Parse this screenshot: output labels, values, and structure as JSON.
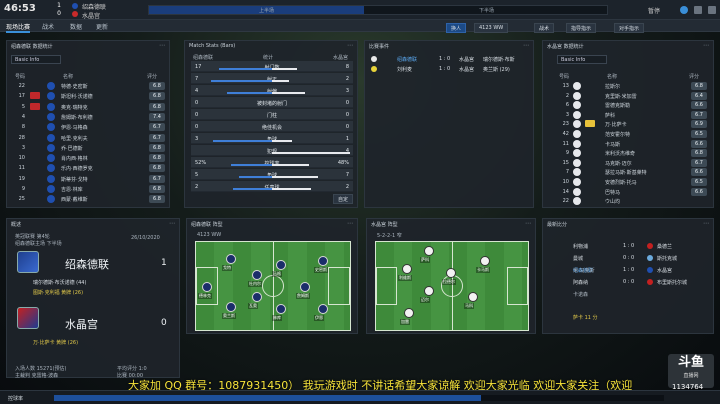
{
  "topbar": {
    "clock": "46:53",
    "home_team": "绍森德联",
    "away_team": "水晶宫",
    "home_score": "1",
    "away_score": "0",
    "timeline_label_1": "上半场",
    "timeline_label_2": "下半场",
    "timeline_progress": 0.47,
    "pause_label": "暂停"
  },
  "menu": {
    "items": [
      "现场比赛",
      "战术",
      "数据",
      "更新"
    ]
  },
  "toolbar": {
    "buttons": [
      "换人",
      "4123 WW",
      "战术",
      "指导指示",
      "对手指示"
    ]
  },
  "left_panel": {
    "title": "绍森德联 数据统计",
    "dropdown": "Basic Info",
    "headers": [
      "号码",
      "名称",
      "评分"
    ],
    "players": [
      {
        "num": "22",
        "name": "特德·史密斯",
        "rating": "6.8",
        "tag": ""
      },
      {
        "num": "17",
        "name": "斯坦利·沃诺德",
        "rating": "6.8",
        "tag": "red"
      },
      {
        "num": "5",
        "name": "奥克·瑞特克",
        "rating": "6.8",
        "tag": "red"
      },
      {
        "num": "4",
        "name": "詹姆斯·布利德",
        "rating": "7.4",
        "tag": ""
      },
      {
        "num": "8",
        "name": "伊恩·马格森",
        "rating": "6.7",
        "tag": ""
      },
      {
        "num": "28",
        "name": "哈里·克利夫",
        "rating": "6.7",
        "tag": ""
      },
      {
        "num": "3",
        "name": "乔·巴德斯",
        "rating": "6.8",
        "tag": ""
      },
      {
        "num": "10",
        "name": "肖内西·格林",
        "rating": "6.8",
        "tag": ""
      },
      {
        "num": "11",
        "name": "乐内·西德罗克",
        "rating": "6.8",
        "tag": ""
      },
      {
        "num": "19",
        "name": "斯蒂芬·戈特",
        "rating": "6.7",
        "tag": ""
      },
      {
        "num": "9",
        "name": "吉恩·林库",
        "rating": "6.8",
        "tag": ""
      },
      {
        "num": "25",
        "name": "西蒙·戴维斯",
        "rating": "6.8",
        "tag": ""
      }
    ]
  },
  "stats_panel": {
    "title": "Match Stats (Bars)",
    "headers": [
      "绍森德联",
      "统计",
      "水晶宫"
    ],
    "rows": [
      {
        "home": "17",
        "label": "射门数",
        "away": "8"
      },
      {
        "home": "7",
        "label": "射正",
        "away": "2"
      },
      {
        "home": "4",
        "label": "射偏",
        "away": "3"
      },
      {
        "home": "0",
        "label": "被封堵的射门",
        "away": "0"
      },
      {
        "home": "0",
        "label": "门柱",
        "away": "0"
      },
      {
        "home": "0",
        "label": "绝佳机会",
        "away": "0"
      },
      {
        "home": "3",
        "label": "角球",
        "away": "1"
      },
      {
        "home": "",
        "label": "犯规",
        "away": "4"
      },
      {
        "home": "52%",
        "label": "控球率",
        "away": "48%"
      },
      {
        "home": "5",
        "label": "角球",
        "away": "7"
      },
      {
        "home": "2",
        "label": "任意球",
        "away": "2"
      }
    ],
    "footer_button": "自定"
  },
  "events_panel": {
    "title": "比赛事件",
    "events": [
      {
        "team": "绍森德联",
        "score": "1 : 0",
        "away": "水晶宫",
        "desc": "瑞尔德斯·布斯"
      },
      {
        "team": "刘利麦",
        "score": "1 : 0",
        "away": "水晶宫",
        "desc": "奥兰斯 (29)"
      }
    ]
  },
  "right_panel": {
    "title": "水晶宫 数据统计",
    "dropdown": "Basic Info",
    "headers": [
      "号码",
      "名称",
      "评分"
    ],
    "players": [
      {
        "num": "13",
        "name": "拉斯尔",
        "rating": "6.8"
      },
      {
        "num": "2",
        "name": "克里斯·米加雷",
        "rating": "6.4"
      },
      {
        "num": "6",
        "name": "雷德克斯勒",
        "rating": "6.6"
      },
      {
        "num": "3",
        "name": "萨科",
        "rating": "6.7"
      },
      {
        "num": "23",
        "name": "万·比萨卡",
        "rating": "6.9"
      },
      {
        "num": "42",
        "name": "范安霍尔特",
        "rating": "6.5"
      },
      {
        "num": "11",
        "name": "卡马斯",
        "rating": "6.6"
      },
      {
        "num": "9",
        "name": "米利沃杰维奇",
        "rating": "6.8"
      },
      {
        "num": "15",
        "name": "马克斯·迈尔",
        "rating": "6.7"
      },
      {
        "num": "7",
        "name": "瑟拉马斯·斯基莱特",
        "rating": "6.6"
      },
      {
        "num": "10",
        "name": "安德烈斯·托马",
        "rating": "6.5"
      },
      {
        "num": "14",
        "name": "巴特马",
        "rating": "6.6"
      },
      {
        "num": "22",
        "name": "ウ山均",
        "rating": ""
      }
    ]
  },
  "summary_panel": {
    "title": "概述",
    "meta_1": "英冠联赛 第4轮",
    "date": "26/10/2020",
    "meta_2": "绍森德联主场 下半场",
    "home_name": "绍森德联",
    "home_score": "1",
    "scorer": "瑞尔德斯·布沃诺德 (44)",
    "home_card": "图斯·克利福 黄牌 (26)",
    "away_name": "水晶宫",
    "away_score": "0",
    "away_card": "万·比萨卡 黄牌 (26)",
    "attendance": "入场人数 15271(预估)",
    "referee": "主裁判 克雷格·波森",
    "stat_l": "平均评分 1:0",
    "stat_r": "比赛 00:00"
  },
  "home_formation": {
    "title": "绍森德联 阵型",
    "formation": "4123 WW",
    "names": [
      "德林克",
      "戈特",
      "奥兰斯",
      "杜内尔",
      "瓦奥",
      "马格",
      "林库",
      "詹姆斯",
      "史密斯",
      "伊恩"
    ]
  },
  "away_formation": {
    "title": "水晶宫 阵型",
    "formation": "5-2-2-1 窄",
    "names": [
      "萨科",
      "利维斯",
      "拉德尔",
      "迈尔",
      "马科",
      "加雷",
      "卡马斯"
    ]
  },
  "other_results": {
    "title": "最新比分",
    "rows": [
      {
        "home": "利物浦",
        "score": "1 : 0",
        "away": "桑德兰"
      },
      {
        "home": "曼城",
        "score": "0 : 0",
        "away": "斯托克城"
      },
      {
        "home": "绍森德联",
        "score": "1 : 0",
        "away": "水晶宫"
      },
      {
        "home": "阿森纳",
        "score": "0 : 0",
        "away": "布里斯托尔城"
      }
    ],
    "sub_1": "米·马克斯",
    "sub_2": "卡诺森",
    "sub_3": "萨卡 11 分"
  },
  "danmaku": "大家加 QQ 群号：1087931450）  我玩游戏时 不讲话希望大家谅解 欢迎大家光临  欢迎大家关注（欢迎",
  "bottom_bar": {
    "label": "控球率",
    "progress": 0.7
  },
  "logo": {
    "brand": "斗鱼",
    "sub": "直播网",
    "viewers": "1134764"
  }
}
